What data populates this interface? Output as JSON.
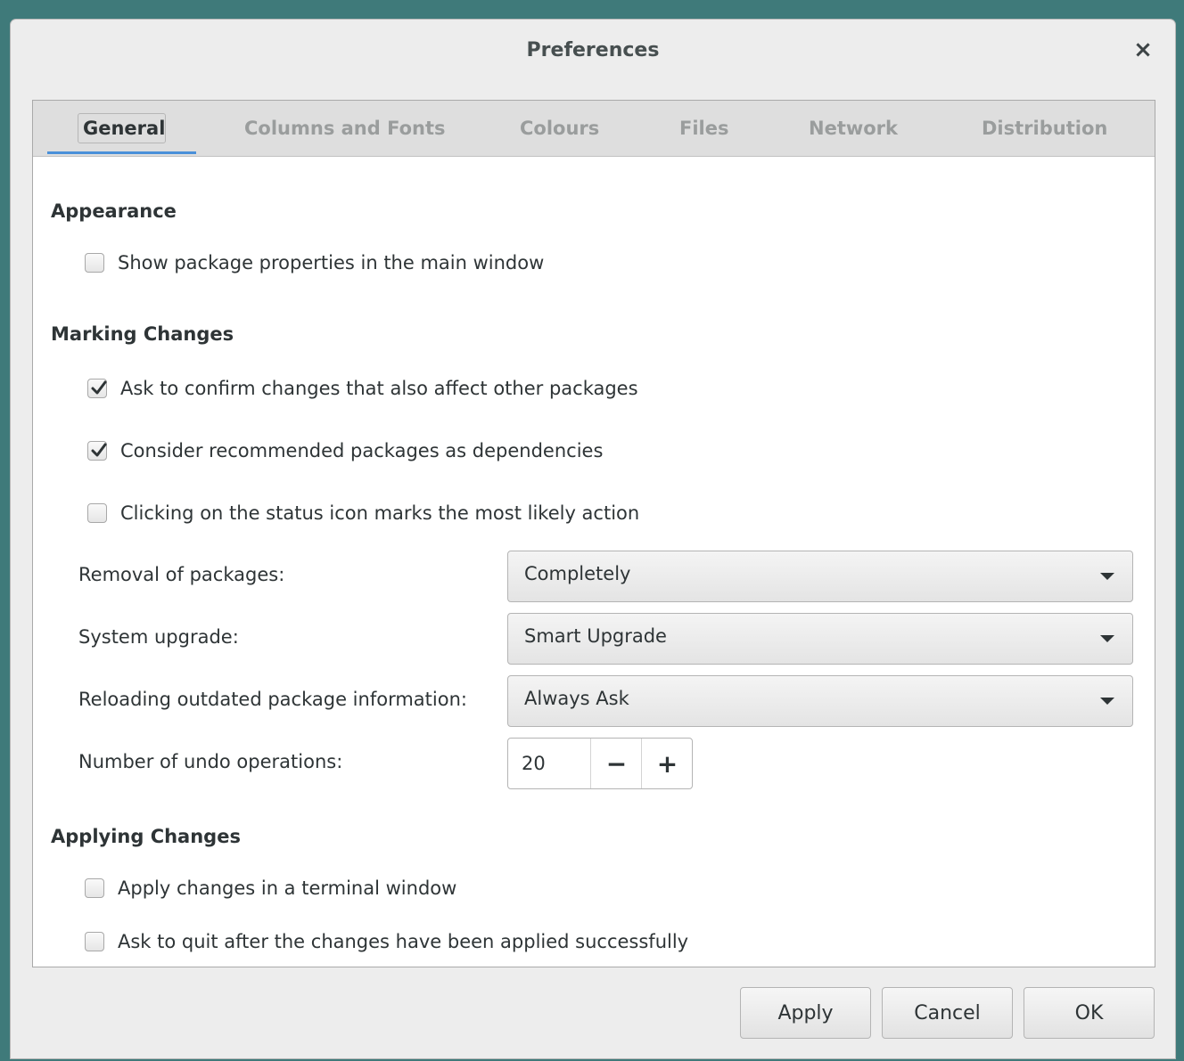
{
  "window": {
    "title": "Preferences",
    "close_glyph": "×"
  },
  "tabs": [
    {
      "label": "General",
      "active": true
    },
    {
      "label": "Columns and Fonts",
      "active": false
    },
    {
      "label": "Colours",
      "active": false
    },
    {
      "label": "Files",
      "active": false
    },
    {
      "label": "Network",
      "active": false
    },
    {
      "label": "Distribution",
      "active": false
    }
  ],
  "appearance": {
    "title": "Appearance",
    "options": [
      {
        "label": "Show package properties in the main window",
        "checked": false
      }
    ]
  },
  "marking": {
    "title": "Marking Changes",
    "options": [
      {
        "label": "Ask to confirm changes that also affect other packages",
        "checked": true
      },
      {
        "label": "Consider recommended packages as dependencies",
        "checked": true
      },
      {
        "label": "Clicking on the status icon marks the most likely action",
        "checked": false
      }
    ],
    "removal": {
      "label": "Removal of packages:",
      "value": "Completely"
    },
    "upgrade": {
      "label": "System upgrade:",
      "value": "Smart Upgrade"
    },
    "reloading": {
      "label": "Reloading outdated package information:",
      "value": "Always Ask"
    },
    "undo": {
      "label": "Number of undo operations:",
      "value": "20",
      "minus": "−",
      "plus": "+"
    }
  },
  "applying": {
    "title": "Applying Changes",
    "options": [
      {
        "label": "Apply changes in a terminal window",
        "checked": false
      },
      {
        "label": "Ask to quit after the changes have been applied successfully",
        "checked": false
      }
    ]
  },
  "buttons": {
    "apply": "Apply",
    "cancel": "Cancel",
    "ok": "OK"
  },
  "colors": {
    "accent": "#4a90d9",
    "desktop": "#3f7a7a"
  },
  "icons": {
    "check": "check-icon",
    "dropdown": "chevron-down-icon",
    "close": "close-icon"
  }
}
